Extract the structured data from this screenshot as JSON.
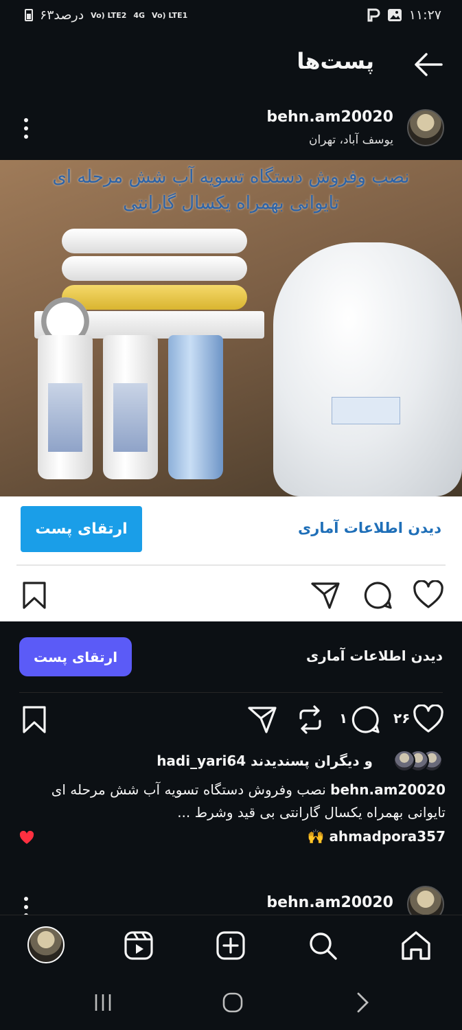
{
  "status_bar": {
    "time": "۱۱:۲۷",
    "battery_text": "۶۳درصد",
    "sim1": "Vo) LTE1",
    "sim2": "Vo) LTE2",
    "network": "4G"
  },
  "header": {
    "title": "پست‌ها"
  },
  "post": {
    "username": "behn.am20020",
    "location": "یوسف آباد، تهران",
    "image_caption_line1": "نصب وفروش دستگاه تسویه آب شش مرحله ای",
    "image_caption_line2": "تایوانی بهمراه یکسال گارانتی",
    "boost_light_label": "ارتقای پست",
    "insights_light_label": "دیدن اطلاعات آماری",
    "boost_dark_label": "ارتقای پست",
    "insights_dark_label": "دیدن اطلاعات آماری",
    "like_count": "۲۶",
    "comment_count": "۱",
    "likes_user": "hadi_yari64",
    "likes_suffix": "و دیگران پسندیدند",
    "caption_user": "behn.am20020",
    "caption_text": "نصب وفروش دستگاه تسویه آب شش مرحله ای تایوانی بهمراه یکسال گارانتی بی قید وشرط ...",
    "comment_user": "ahmadpora357",
    "comment_text": "🙌"
  },
  "next_post": {
    "username": "behn.am20020"
  },
  "colors": {
    "background": "#0c1014",
    "boost_blue": "#1a9ee8",
    "boost_purple": "#5b5bf7",
    "like_red": "#ff3040"
  },
  "icons": {
    "header": [
      "back-arrow-icon"
    ],
    "post": [
      "more-options-icon",
      "bookmark-icon",
      "share-icon",
      "repost-icon",
      "comment-icon",
      "heart-icon"
    ],
    "nav": [
      "home-icon",
      "search-icon",
      "create-icon",
      "reels-icon",
      "profile-avatar"
    ],
    "system": [
      "recent-apps-icon",
      "home-pill-icon",
      "back-chevron-icon"
    ]
  }
}
